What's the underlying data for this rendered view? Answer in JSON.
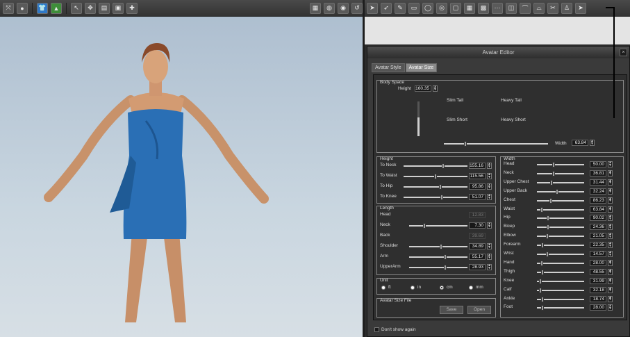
{
  "left_toolbar": {
    "icons": [
      "transform-icon",
      "record-icon",
      "garment-icon",
      "fabric-icon",
      "select-icon",
      "move-icon",
      "book-icon",
      "image-icon",
      "plus-icon"
    ]
  },
  "viewport_tools": {
    "icons": [
      "grid-icon",
      "body-icon",
      "body-compare-icon",
      "reset-icon"
    ]
  },
  "right_toolbar": {
    "icons": [
      "pointer-icon",
      "pointer2-icon",
      "pointer3-icon",
      "pen-icon",
      "rect-icon",
      "circle-icon",
      "ring-icon",
      "square-icon",
      "grid1-icon",
      "grid2-icon",
      "dots-icon",
      "layer-icon",
      "fold-icon",
      "fold2-icon",
      "sew-icon",
      "avatar-icon"
    ]
  },
  "editor": {
    "title": "Avatar Editor",
    "close": "×",
    "tabs": [
      {
        "label": "Avatar Style"
      },
      {
        "label": "Avatar Size"
      }
    ],
    "body_space": {
      "label": "Body Space",
      "height_label": "Height",
      "height_value": "160.35",
      "height_level": 0.55,
      "quadrants": [
        "Slim Tall",
        "Heavy Tall",
        "Slim Short",
        "Heavy Short"
      ],
      "width_label": "Width",
      "width_value": "63.84",
      "width_level": 0.2
    },
    "height_group": {
      "label": "Height",
      "rows": [
        {
          "label": "To Neck",
          "value": "155.16",
          "level": 0.62
        },
        {
          "label": "To Waist",
          "value": "115.56",
          "level": 0.5
        },
        {
          "label": "To Hip",
          "value": "95.86",
          "level": 0.58
        },
        {
          "label": "To Knee",
          "value": "51.07",
          "level": 0.6
        }
      ]
    },
    "length_group": {
      "label": "Length",
      "rows": [
        {
          "label": "Head",
          "value": "12.83",
          "level": null,
          "dim": true
        },
        {
          "label": "Neck",
          "value": "7.30",
          "level": 0.25,
          "dim": false
        },
        {
          "label": "Back",
          "value": "39.69",
          "level": null,
          "dim": true
        },
        {
          "label": "Shoulder",
          "value": "34.89",
          "level": 0.55,
          "dim": false
        },
        {
          "label": "Arm",
          "value": "55.17",
          "level": 0.62,
          "dim": false
        },
        {
          "label": "UpperArm",
          "value": "28.93",
          "level": 0.62,
          "dim": false
        }
      ]
    },
    "unit_group": {
      "label": "Unit",
      "options": [
        {
          "label": "ft",
          "selected": false
        },
        {
          "label": "in",
          "selected": false
        },
        {
          "label": "cm",
          "selected": true
        },
        {
          "label": "mm",
          "selected": false
        }
      ]
    },
    "file_group": {
      "label": "Avatar Size File",
      "save": "Save",
      "open": "Open"
    },
    "width_group": {
      "label": "Width",
      "rows": [
        {
          "label": "Head",
          "value": "50.00",
          "level": 0.35
        },
        {
          "label": "Neck",
          "value": "36.81",
          "level": 0.35
        },
        {
          "label": "Upper Chest",
          "value": "31.44",
          "level": 0.3
        },
        {
          "label": "Upper Back",
          "value": "32.24",
          "level": 0.42
        },
        {
          "label": "Chest",
          "value": "86.23",
          "level": 0.28
        },
        {
          "label": "Waist",
          "value": "63.84",
          "level": 0.08
        },
        {
          "label": "Hip",
          "value": "90.02",
          "level": 0.22
        },
        {
          "label": "Bicep",
          "value": "24.36",
          "level": 0.22
        },
        {
          "label": "Elbow",
          "value": "21.05",
          "level": 0.2
        },
        {
          "label": "Forearm",
          "value": "22.35",
          "level": 0.1
        },
        {
          "label": "Wrist",
          "value": "14.57",
          "level": 0.2
        },
        {
          "label": "Hand",
          "value": "28.00",
          "level": 0.08
        },
        {
          "label": "Thigh",
          "value": "48.55",
          "level": 0.1
        },
        {
          "label": "Knee",
          "value": "31.99",
          "level": 0.05
        },
        {
          "label": "Calf",
          "value": "32.18",
          "level": 0.05
        },
        {
          "label": "Ankle",
          "value": "18.74",
          "level": 0.1
        },
        {
          "label": "Foot",
          "value": "28.00",
          "level": 0.1
        }
      ]
    },
    "dont_show": "Don't show again"
  },
  "colors": {
    "dress": "#2a6fb5",
    "sky": "#c4d2de",
    "panel": "#2f2f2f"
  }
}
